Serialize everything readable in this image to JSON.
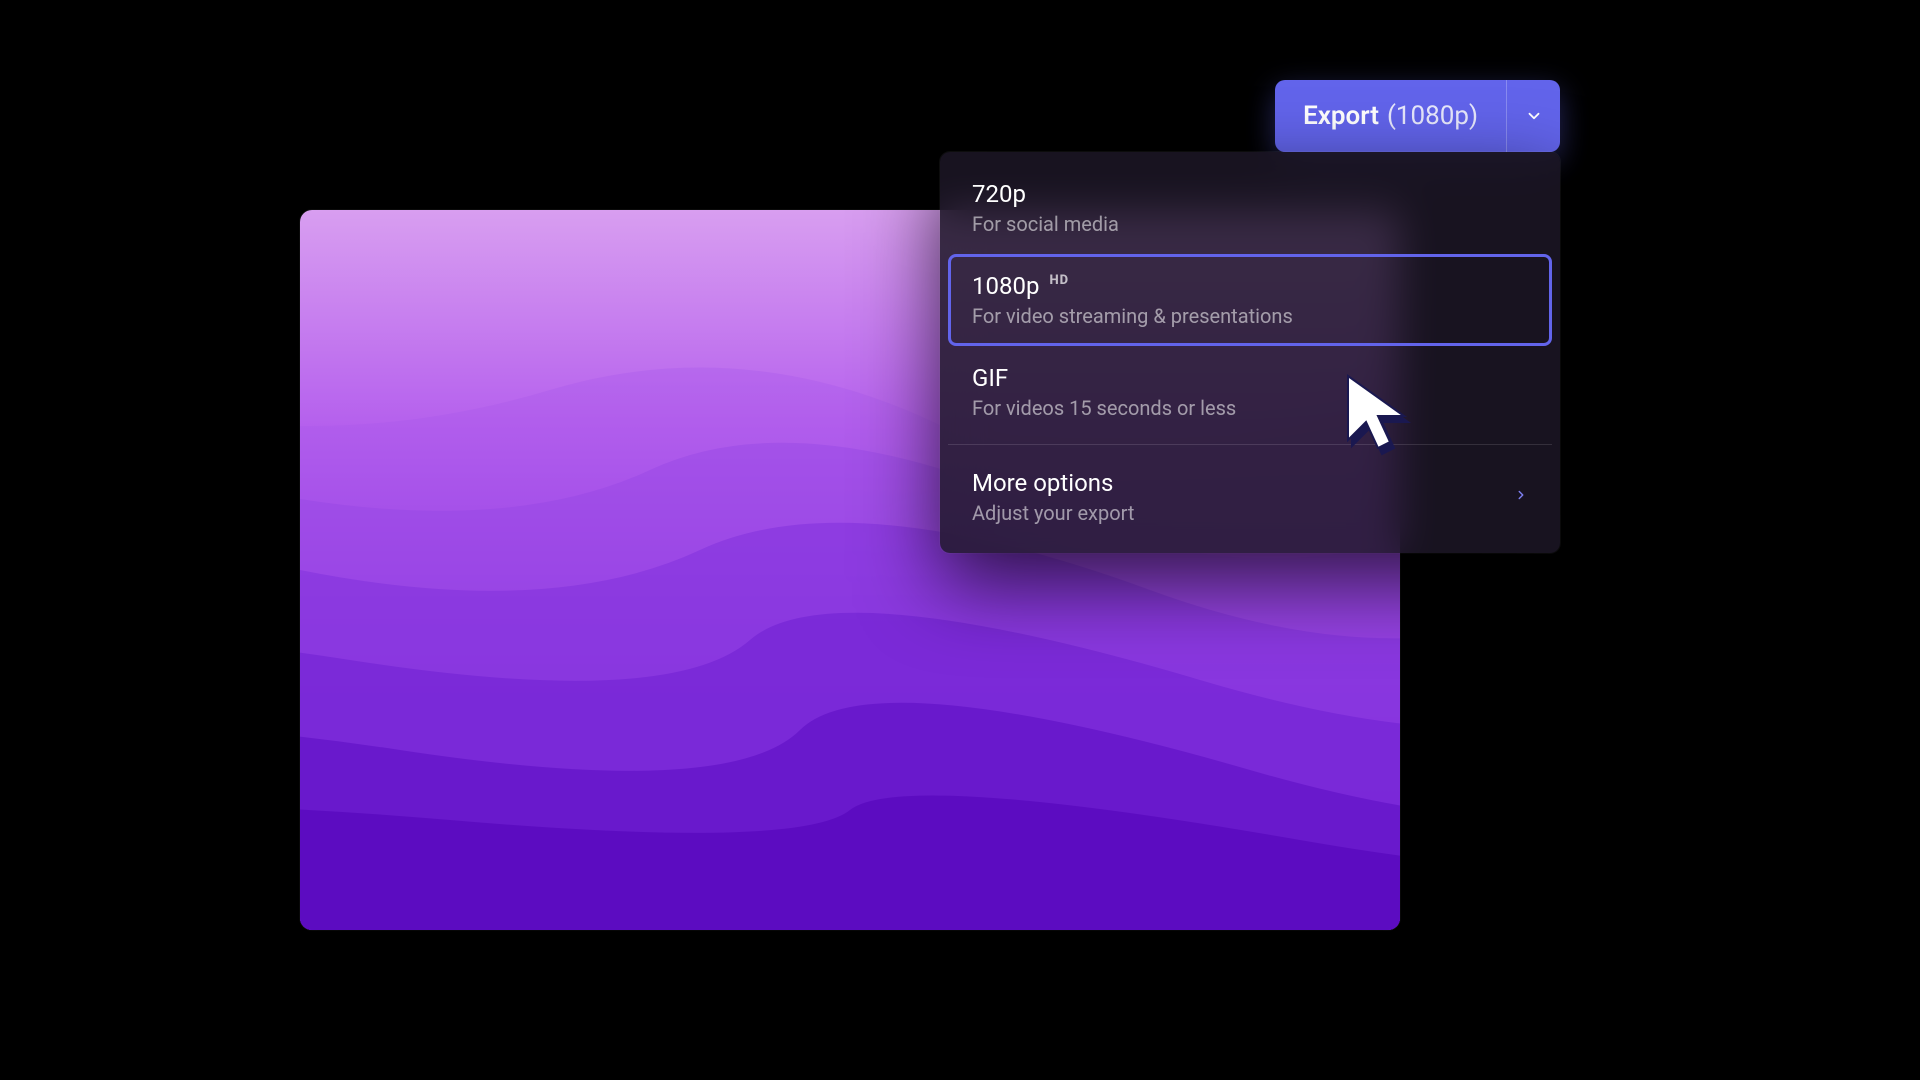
{
  "export_button": {
    "label": "Export",
    "resolution": "(1080p)"
  },
  "dropdown": {
    "items": [
      {
        "title": "720p",
        "subtitle": "For social media",
        "badge": "",
        "selected": false
      },
      {
        "title": "1080p",
        "subtitle": "For video streaming & presentations",
        "badge": "HD",
        "selected": true
      },
      {
        "title": "GIF",
        "subtitle": "For videos 15 seconds or less",
        "badge": "",
        "selected": false
      }
    ],
    "more": {
      "title": "More options",
      "subtitle": "Adjust your export"
    }
  },
  "colors": {
    "accent": "#6264eb",
    "panel": "#1c1626"
  }
}
